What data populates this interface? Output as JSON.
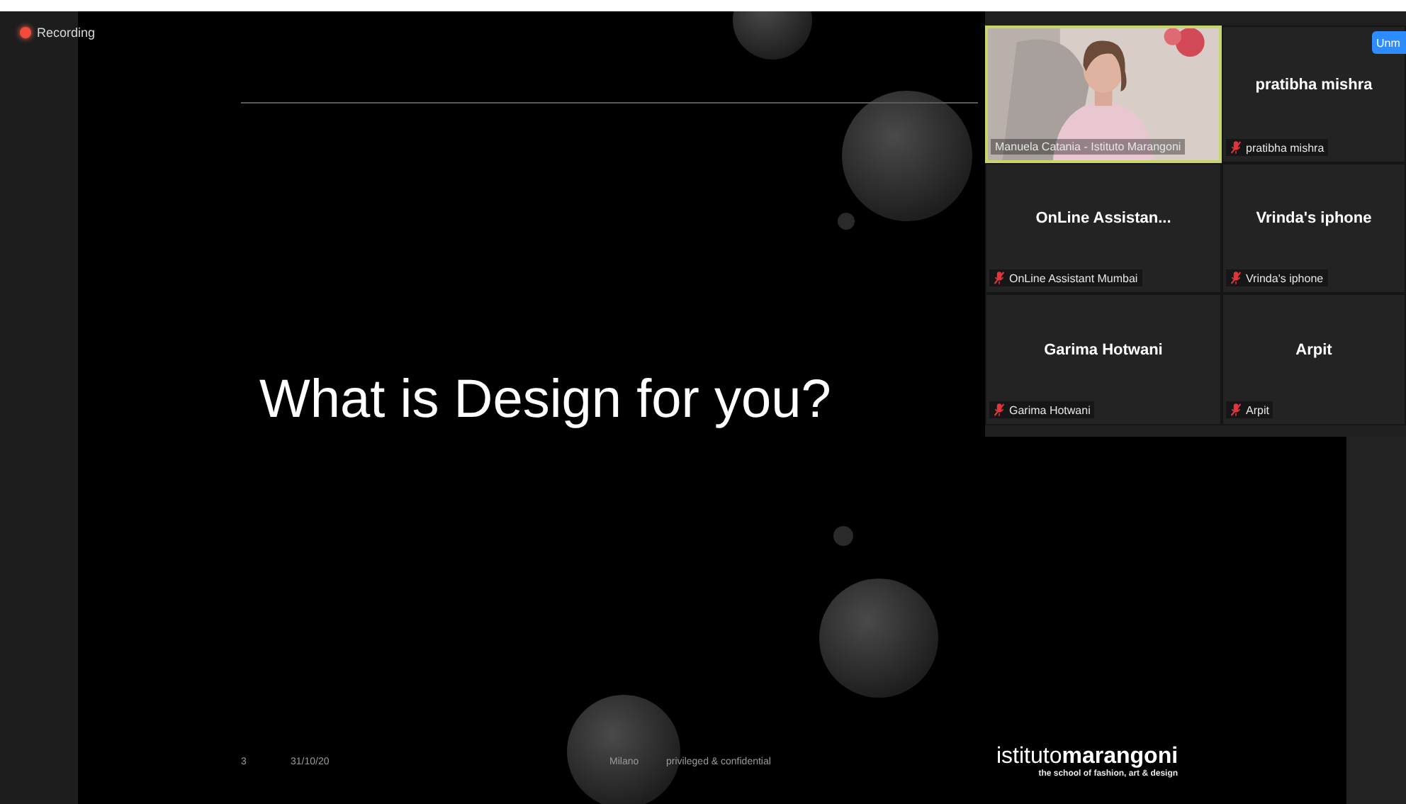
{
  "recording": {
    "label": "Recording"
  },
  "slide": {
    "title": "What is Design for you?",
    "footer": {
      "page": "3",
      "date": "31/10/20",
      "city": "Milano",
      "note": "privileged & confidential"
    },
    "logo": {
      "name": "istituto**marangoni**",
      "tagline": "the school of fashion, art & design"
    }
  },
  "gallery": {
    "unmute_button": "Unm",
    "tiles": [
      {
        "kind": "video",
        "label": "Manuela Catania - Istituto Marangoni",
        "muted": false,
        "active_speaker": true
      },
      {
        "kind": "name",
        "name": "pratibha mishra",
        "label": "pratibha mishra",
        "muted": true,
        "active_speaker": false
      },
      {
        "kind": "name",
        "name": "OnLine Assistan...",
        "label": "OnLine Assistant Mumbai",
        "muted": true,
        "active_speaker": false
      },
      {
        "kind": "name",
        "name": "Vrinda's iphone",
        "label": "Vrinda's iphone",
        "muted": true,
        "active_speaker": false
      },
      {
        "kind": "name",
        "name": "Garima Hotwani",
        "label": "Garima Hotwani",
        "muted": true,
        "active_speaker": false
      },
      {
        "kind": "name",
        "name": "Arpit",
        "label": "Arpit",
        "muted": true,
        "active_speaker": false
      }
    ]
  }
}
